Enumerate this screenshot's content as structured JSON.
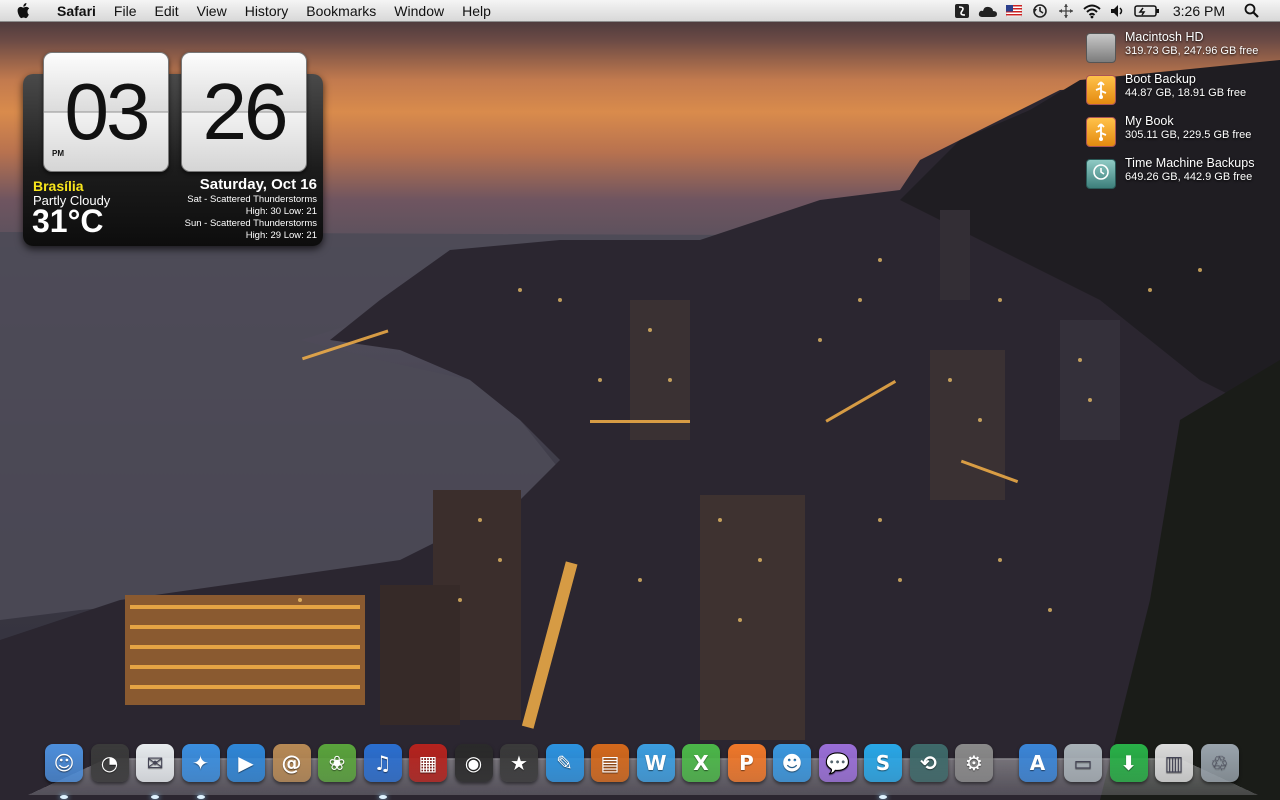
{
  "menubar": {
    "app": "Safari",
    "menus": [
      "File",
      "Edit",
      "View",
      "History",
      "Bookmarks",
      "Window",
      "Help"
    ],
    "status_icons": [
      "script-menu-icon",
      "cloud-icon",
      "us-flag-input-icon",
      "time-machine-icon",
      "spaces-icon",
      "wifi-icon",
      "volume-icon",
      "battery-icon"
    ],
    "clock": "3:26 PM"
  },
  "clock_widget": {
    "hour": "03",
    "minute": "26",
    "ampm": "PM",
    "city": "Brasília",
    "condition": "Partly Cloudy",
    "temperature": "31°C",
    "date": "Saturday, Oct 16",
    "forecast": [
      {
        "line1": "Sat - Scattered Thunderstorms",
        "line2": "High: 30  Low: 21"
      },
      {
        "line1": "Sun - Scattered Thunderstorms",
        "line2": "High: 29  Low: 21"
      }
    ]
  },
  "drives": [
    {
      "name": "Macintosh HD",
      "size": "319.73 GB, 247.96 GB free",
      "icon": "internal-disk-icon",
      "color": "#9c9c9c"
    },
    {
      "name": "Boot Backup",
      "size": "44.87 GB, 18.91 GB free",
      "icon": "external-usb-disk-icon",
      "color": "#f2a31a"
    },
    {
      "name": "My Book",
      "size": "305.11 GB, 229.5 GB free",
      "icon": "external-usb-disk-icon",
      "color": "#f2a31a"
    },
    {
      "name": "Time Machine Backups",
      "size": "649.26 GB, 442.9 GB free",
      "icon": "time-machine-disk-icon",
      "color": "#5fa3a0"
    }
  ],
  "dock": {
    "items": [
      {
        "name": "finder-icon",
        "color": "#4d8fdc",
        "glyph": "☺",
        "running": true
      },
      {
        "name": "dashboard-icon",
        "color": "#3a3a3a",
        "glyph": "◔",
        "running": false
      },
      {
        "name": "mail-icon",
        "color": "#e8ecef",
        "glyph": "✉",
        "running": true
      },
      {
        "name": "safari-icon",
        "color": "#3b8fe0",
        "glyph": "✦",
        "running": true
      },
      {
        "name": "facetime-icon",
        "color": "#2f87d8",
        "glyph": "▶",
        "running": false
      },
      {
        "name": "address-book-icon",
        "color": "#b88a55",
        "glyph": "@",
        "running": false
      },
      {
        "name": "iphoto-icon",
        "color": "#5aa43c",
        "glyph": "❀",
        "running": false
      },
      {
        "name": "itunes-icon",
        "color": "#2b6fd0",
        "glyph": "♫",
        "running": true
      },
      {
        "name": "photo-booth-icon",
        "color": "#b5231e",
        "glyph": "▦",
        "running": false
      },
      {
        "name": "aperture-icon",
        "color": "#2a2a2a",
        "glyph": "◉",
        "running": false
      },
      {
        "name": "imovie-icon",
        "color": "#3a3a3a",
        "glyph": "★",
        "running": false
      },
      {
        "name": "pencil-app-icon",
        "color": "#2c93e0",
        "glyph": "✎",
        "running": false
      },
      {
        "name": "notes-app-icon",
        "color": "#d4691c",
        "glyph": "▤",
        "running": false
      },
      {
        "name": "office-word-icon",
        "color": "#3c9ee0",
        "glyph": "W",
        "running": false
      },
      {
        "name": "office-excel-icon",
        "color": "#4cb849",
        "glyph": "X",
        "running": false
      },
      {
        "name": "office-powerpoint-icon",
        "color": "#f0782a",
        "glyph": "P",
        "running": false
      },
      {
        "name": "messenger-icon",
        "color": "#3a98e0",
        "glyph": "☻",
        "running": false
      },
      {
        "name": "ichat-icon",
        "color": "#9a6fd8",
        "glyph": "💬",
        "running": false
      },
      {
        "name": "skype-icon",
        "color": "#29a8e8",
        "glyph": "S",
        "running": true
      },
      {
        "name": "time-machine-icon",
        "color": "#3e6a6a",
        "glyph": "⟲",
        "running": false
      },
      {
        "name": "system-preferences-icon",
        "color": "#8a8a8a",
        "glyph": "⚙",
        "running": false
      },
      {
        "name": "app-store-icon",
        "color": "#3b86d8",
        "glyph": "A",
        "running": false
      },
      {
        "name": "documents-folder-icon",
        "color": "#a9b2b8",
        "glyph": "▭",
        "running": false
      },
      {
        "name": "downloads-folder-icon",
        "color": "#29b148",
        "glyph": "⬇",
        "running": false
      },
      {
        "name": "stack-folder-icon",
        "color": "#dcdcdc",
        "glyph": "▥",
        "running": false
      },
      {
        "name": "trash-icon",
        "color": "#9aa4ad",
        "glyph": "♲",
        "running": false
      }
    ]
  }
}
